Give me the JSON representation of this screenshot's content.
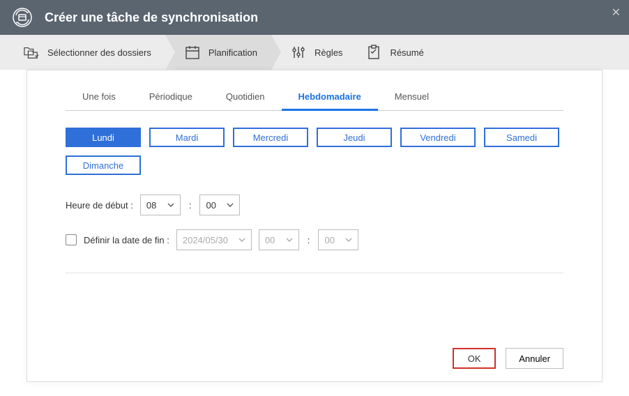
{
  "header": {
    "title": "Créer une tâche de synchronisation"
  },
  "wizard": {
    "step1": "Sélectionner des dossiers",
    "step2": "Planification",
    "step3": "Règles",
    "step4": "Résumé"
  },
  "tabs": {
    "once": "Une fois",
    "periodic": "Périodique",
    "daily": "Quotidien",
    "weekly": "Hebdomadaire",
    "monthly": "Mensuel"
  },
  "days": {
    "mon": "Lundi",
    "tue": "Mardi",
    "wed": "Mercredi",
    "thu": "Jeudi",
    "fri": "Vendredi",
    "sat": "Samedi",
    "sun": "Dimanche"
  },
  "start_time": {
    "label": "Heure de début :",
    "hour": "08",
    "minute": "00"
  },
  "end_date": {
    "label": "Définir la date de fin :",
    "date": "2024/05/30",
    "hour": "00",
    "minute": "00"
  },
  "buttons": {
    "ok": "OK",
    "cancel": "Annuler"
  }
}
